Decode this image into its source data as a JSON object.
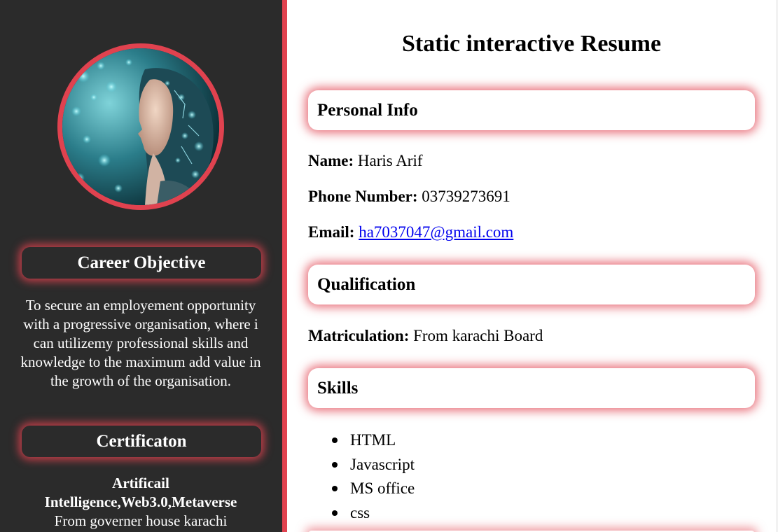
{
  "sidebar": {
    "avatar_alt": "Profile picture",
    "career_objective": {
      "heading": "Career Objective",
      "text": "To secure an employement opportunity with a progressive organisation, where i can utilizemy professional skills and knowledge to the maximum add value in the growth of the organisation."
    },
    "certification": {
      "heading": "Certificaton",
      "title": "Artificail Intelligence,Web3.0,Metaverse",
      "detail": "From governer house karachi"
    }
  },
  "main": {
    "title": "Static interactive Resume",
    "personal_info": {
      "heading": "Personal Info",
      "name_label": "Name:",
      "name_value": "Haris Arif",
      "phone_label": "Phone Number:",
      "phone_value": "03739273691",
      "email_label": "Email:",
      "email_value": "ha7037047@gmail.com"
    },
    "qualification": {
      "heading": "Qualification",
      "matric_label": "Matriculation:",
      "matric_value": "From karachi Board"
    },
    "skills": {
      "heading": "Skills",
      "items": [
        "HTML",
        "Javascript",
        "MS office",
        "css"
      ]
    }
  },
  "colors": {
    "accent": "#e0424f",
    "sidebar_bg": "#2b2b2b",
    "link": "#0000ee"
  }
}
